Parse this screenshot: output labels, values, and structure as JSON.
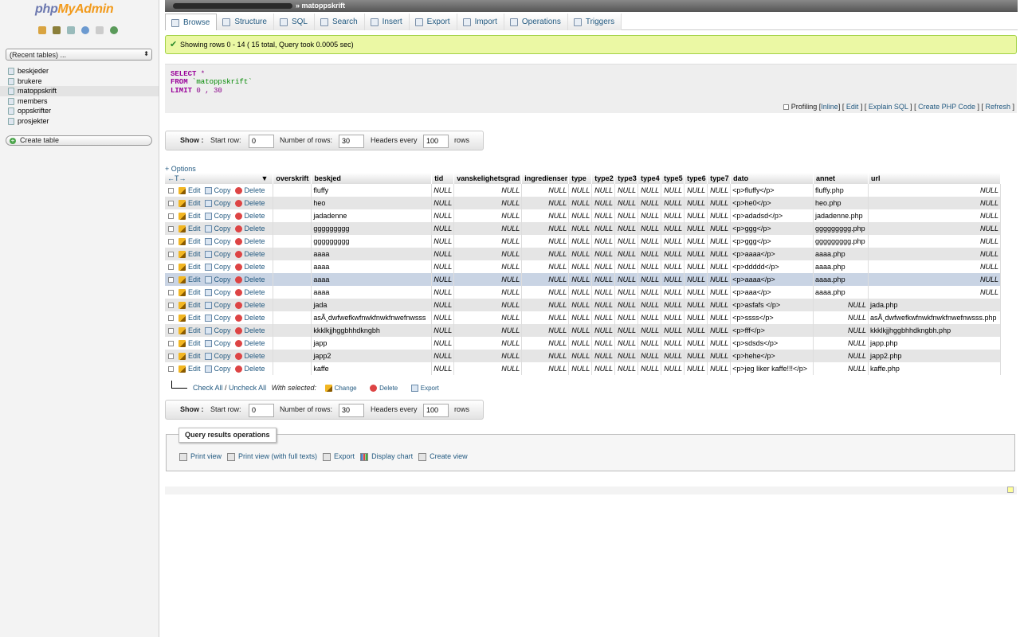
{
  "sidebar": {
    "logo_php": "php",
    "logo_ma": "MyAdmin",
    "recent_tables": "(Recent tables) ...",
    "tables": [
      "beskjeder",
      "brukere",
      "matoppskrift",
      "members",
      "oppskrifter",
      "prosjekter"
    ],
    "create_table": "Create table"
  },
  "breadcrumb": {
    "table": "matoppskrift"
  },
  "tabs": [
    "Browse",
    "Structure",
    "SQL",
    "Search",
    "Insert",
    "Export",
    "Import",
    "Operations",
    "Triggers"
  ],
  "message": "Showing rows 0 - 14 ( 15 total, Query took 0.0005 sec)",
  "sql": {
    "select": "SELECT",
    "star": " *",
    "from": "FROM",
    "table": " `matoppskrift`",
    "limit": "LIMIT",
    "limit_vals": " 0 , 30",
    "profiling": "Profiling",
    "links": [
      "Inline",
      "Edit",
      "Explain SQL",
      "Create PHP Code",
      "Refresh"
    ]
  },
  "nav": {
    "show": "Show :",
    "start_row_label": "Start row:",
    "start_row": "0",
    "num_rows_label": "Number of rows:",
    "num_rows": "30",
    "headers_every_label": "Headers every",
    "headers_every": "100",
    "rows": "rows"
  },
  "options": "+ Options",
  "columns": [
    "overskrift",
    "beskjed",
    "tid",
    "vanskelighetsgrad",
    "ingredienser",
    "type",
    "type2",
    "type3",
    "type4",
    "type5",
    "type6",
    "type7",
    "dato",
    "annet",
    "url"
  ],
  "actions": {
    "edit": "Edit",
    "copy": "Copy",
    "delete": "Delete"
  },
  "null": "NULL",
  "rows": [
    {
      "beskjed": "fluffy",
      "dato": "<p>fluffy</p>",
      "annet": "fluffy.php",
      "url": "NULL"
    },
    {
      "beskjed": "heo",
      "dato": "<p>he0</p>",
      "annet": "heo.php",
      "url": "NULL"
    },
    {
      "beskjed": "jadadenne",
      "dato": "<p>adadsd</p>",
      "annet": "jadadenne.php",
      "url": "NULL"
    },
    {
      "beskjed": "ggggggggg",
      "dato": "<p>ggg</p>",
      "annet": "ggggggggg.php",
      "url": "NULL"
    },
    {
      "beskjed": "ggggggggg",
      "dato": "<p>ggg</p>",
      "annet": "ggggggggg.php",
      "url": "NULL"
    },
    {
      "beskjed": "aaaa",
      "dato": "<p>aaaa</p>",
      "annet": "aaaa.php",
      "url": "NULL"
    },
    {
      "beskjed": "aaaa",
      "dato": "<p>ddddd</p>",
      "annet": "aaaa.php",
      "url": "NULL"
    },
    {
      "beskjed": "aaaa",
      "dato": "<p>aaaa</p>",
      "annet": "aaaa.php",
      "url": "NULL"
    },
    {
      "beskjed": "aaaa",
      "dato": "<p>aaa</p>",
      "annet": "aaaa.php",
      "url": "NULL"
    },
    {
      "beskjed": "jada",
      "dato": "<p>asfafs  </p>",
      "annet": "NULL",
      "url": "jada.php"
    },
    {
      "beskjed": "asÃ¸dwfwefkwfnwkfnwkfnwefnwsss",
      "dato": "<p>ssss</p>",
      "annet": "NULL",
      "url": "asÃ¸dwfwefkwfnwkfnwkfnwefnwsss.php"
    },
    {
      "beskjed": "kkklkjjhggbhhdkngbh",
      "dato": "<p>fff</p>",
      "annet": "NULL",
      "url": "kkklkjjhggbhhdkngbh.php"
    },
    {
      "beskjed": "japp",
      "dato": "<p>sdsds</p>",
      "annet": "NULL",
      "url": "japp.php"
    },
    {
      "beskjed": "japp2",
      "dato": "<p>hehe</p>",
      "annet": "NULL",
      "url": "japp2.php"
    },
    {
      "beskjed": "kaffe",
      "dato": "<p>jeg liker kaffe!!!</p>",
      "annet": "NULL",
      "url": "kaffe.php"
    }
  ],
  "with_selected": {
    "check_all": "Check All",
    "sep": " / ",
    "uncheck_all": "Uncheck All",
    "label": "With selected:",
    "change": "Change",
    "delete": "Delete",
    "export": "Export"
  },
  "query_ops": {
    "legend": "Query results operations",
    "print_view": "Print view",
    "print_view_full": "Print view (with full texts)",
    "export": "Export",
    "display_chart": "Display chart",
    "create_view": "Create view"
  }
}
